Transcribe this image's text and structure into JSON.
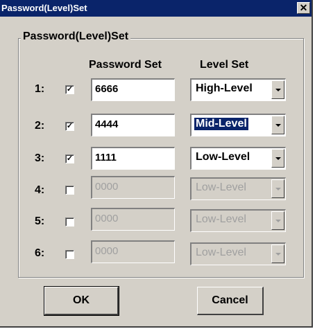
{
  "window": {
    "title": "Password(Level)Set",
    "close_glyph": "✕"
  },
  "group": {
    "label": "Password(Level)Set"
  },
  "headers": {
    "password": "Password Set",
    "level": "Level Set"
  },
  "rows": [
    {
      "num": "1:",
      "checked": true,
      "password": "6666",
      "level": "High-Level",
      "enabled": true
    },
    {
      "num": "2:",
      "checked": true,
      "password": "4444",
      "level": "Mid-Level",
      "enabled": true,
      "level_selected": true
    },
    {
      "num": "3:",
      "checked": true,
      "password": "1111",
      "level": "Low-Level",
      "enabled": true
    },
    {
      "num": "4:",
      "checked": false,
      "password": "0000",
      "level": "Low-Level",
      "enabled": false
    },
    {
      "num": "5:",
      "checked": false,
      "password": "0000",
      "level": "Low-Level",
      "enabled": false
    },
    {
      "num": "6:",
      "checked": false,
      "password": "0000",
      "level": "Low-Level",
      "enabled": false
    }
  ],
  "buttons": {
    "ok": "OK",
    "cancel": "Cancel"
  },
  "check_glyph": "✓"
}
